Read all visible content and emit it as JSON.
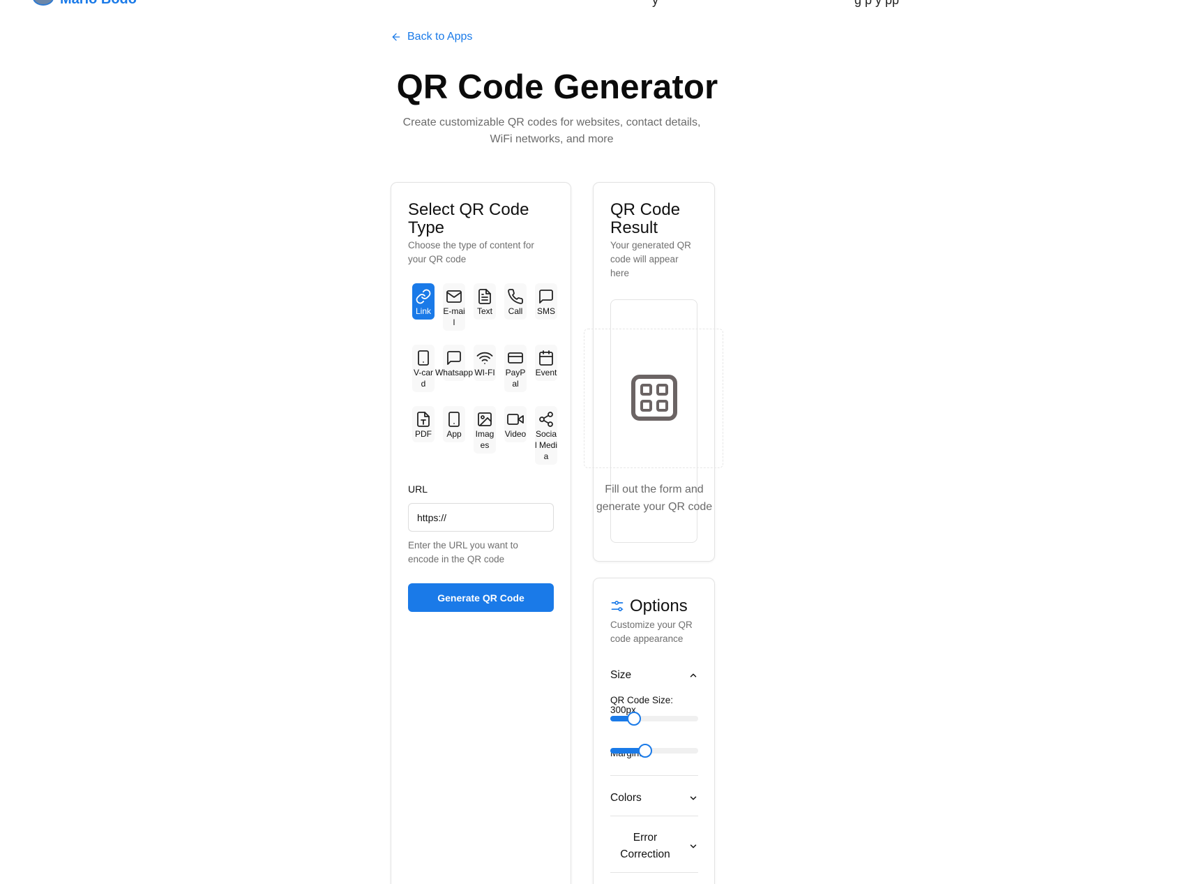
{
  "nav": {
    "brand": "Mario Bodo",
    "item1": "y",
    "item2": "g   p y    pp"
  },
  "back_link": "Back to Apps",
  "page": {
    "title": "QR Code Generator",
    "subtitle": "Create customizable QR codes for websites, contact details, WiFi networks, and more"
  },
  "type_card": {
    "title": "Select QR Code Type",
    "description": "Choose the type of content for your QR code",
    "types": [
      {
        "label": "Link",
        "icon": "link-icon",
        "active": true
      },
      {
        "label": "E-mail",
        "icon": "mail-icon",
        "active": false
      },
      {
        "label": "Text",
        "icon": "file-text-icon",
        "active": false
      },
      {
        "label": "Call",
        "icon": "phone-icon",
        "active": false
      },
      {
        "label": "SMS",
        "icon": "message-icon",
        "active": false
      },
      {
        "label": "V-card",
        "icon": "smartphone-icon",
        "active": false
      },
      {
        "label": "Whatsapp",
        "icon": "chat-icon",
        "active": false
      },
      {
        "label": "WI-FI",
        "icon": "wifi-icon",
        "active": false
      },
      {
        "label": "PayPal",
        "icon": "credit-card-icon",
        "active": false
      },
      {
        "label": "Event",
        "icon": "calendar-icon",
        "active": false
      },
      {
        "label": "PDF",
        "icon": "pdf-icon",
        "active": false
      },
      {
        "label": "App",
        "icon": "app-icon",
        "active": false
      },
      {
        "label": "Images",
        "icon": "image-icon",
        "active": false
      },
      {
        "label": "Video",
        "icon": "video-icon",
        "active": false
      },
      {
        "label": "Social Media",
        "icon": "share-icon",
        "active": false
      }
    ],
    "field_label": "URL",
    "field_value": "https://",
    "field_help": "Enter the URL you want to encode in the QR code",
    "generate_label": "Generate QR Code"
  },
  "result_card": {
    "title": "QR Code Result",
    "description": "Your generated QR code will appear here",
    "placeholder_icon": "qr-code-icon",
    "hint": "Fill out the form and generate your QR code"
  },
  "options_card": {
    "title": "Options",
    "description": "Customize your QR code appearance",
    "size_section": "Size",
    "size_label": "QR Code Size: 300px",
    "size_fraction": 0.27,
    "margin_label": "Margin: 4",
    "margin_fraction": 0.4,
    "colors_section": "Colors",
    "error_section": "Error Correction"
  },
  "colors": {
    "accent": "#1a7ae8",
    "muted_text": "#6f6f6f",
    "border": "#e3e3e3"
  }
}
